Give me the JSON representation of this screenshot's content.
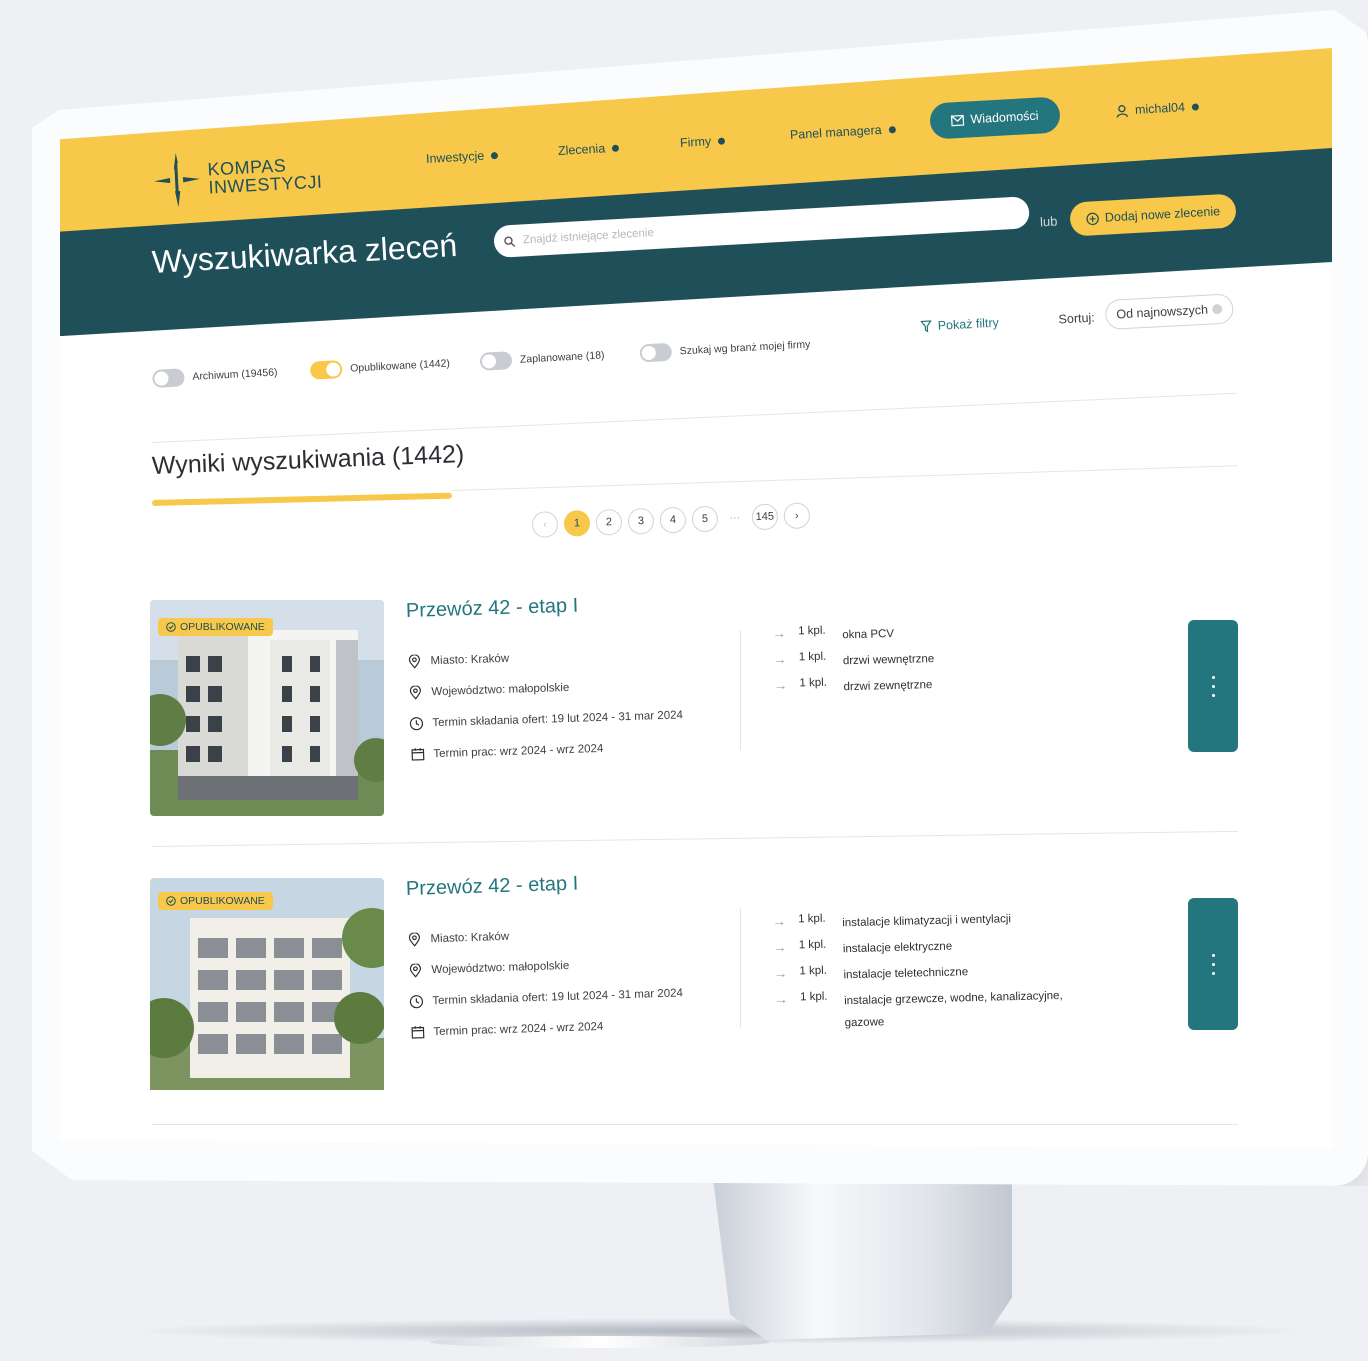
{
  "brand": {
    "line1": "KOMPAS",
    "line2": "INWESTYCJI"
  },
  "nav": {
    "items": [
      {
        "label": "Inwestycje"
      },
      {
        "label": "Zlecenia"
      },
      {
        "label": "Firmy"
      },
      {
        "label": "Panel managera"
      }
    ],
    "messages_label": "Wiadomości",
    "user_label": "michal04"
  },
  "header": {
    "title": "Wyszukiwarka zleceń",
    "search_placeholder": "Znajdź istniejące zlecenie",
    "or_label": "lub",
    "add_label": "Dodaj nowe zlecenie"
  },
  "filters": {
    "toggles": [
      {
        "label": "Archiwum (19456)",
        "on": false
      },
      {
        "label": "Opublikowane (1442)",
        "on": true
      },
      {
        "label": "Zaplanowane (18)",
        "on": false
      },
      {
        "label": "Szukaj wg branż mojej firmy",
        "on": false
      }
    ],
    "show_filters_label": "Pokaż filtry",
    "sort_label": "Sortuj:",
    "sort_value": "Od najnowszych"
  },
  "results": {
    "title": "Wyniki wyszukiwania (1442)",
    "pages": [
      "1",
      "2",
      "3",
      "4",
      "5"
    ],
    "ellipsis": "···",
    "last_page": "145",
    "current_page": "1"
  },
  "listings": [
    {
      "badge": "OPUBLIKOWANE",
      "title": "Przewóz 42 - etap I",
      "city": "Miasto:  Kraków",
      "region": "Województwo:  małopolskie",
      "offer_term": "Termin składania ofert:  19 lut 2024 - 31 mar 2024",
      "work_term": "Termin prac:  wrz 2024 - wrz 2024",
      "items": [
        {
          "qty": "1 kpl.",
          "name": "okna PCV"
        },
        {
          "qty": "1 kpl.",
          "name": "drzwi wewnętrzne"
        },
        {
          "qty": "1 kpl.",
          "name": "drzwi zewnętrzne"
        }
      ]
    },
    {
      "badge": "OPUBLIKOWANE",
      "title": "Przewóz 42 - etap I",
      "city": "Miasto:  Kraków",
      "region": "Województwo:  małopolskie",
      "offer_term": "Termin składania ofert:  19 lut 2024 - 31 mar 2024",
      "work_term": "Termin prac:  wrz 2024 - wrz 2024",
      "items": [
        {
          "qty": "1 kpl.",
          "name": "instalacje klimatyzacji i wentylacji"
        },
        {
          "qty": "1 kpl.",
          "name": "instalacje elektryczne"
        },
        {
          "qty": "1 kpl.",
          "name": "instalacje teletechniczne"
        },
        {
          "qty": "1 kpl.",
          "name": "instalacje grzewcze, wodne, kanalizacyjne, gazowe"
        }
      ]
    }
  ],
  "colors": {
    "accent_yellow": "#f7c84a",
    "brand_teal": "#1f5059",
    "button_teal": "#23767d"
  }
}
